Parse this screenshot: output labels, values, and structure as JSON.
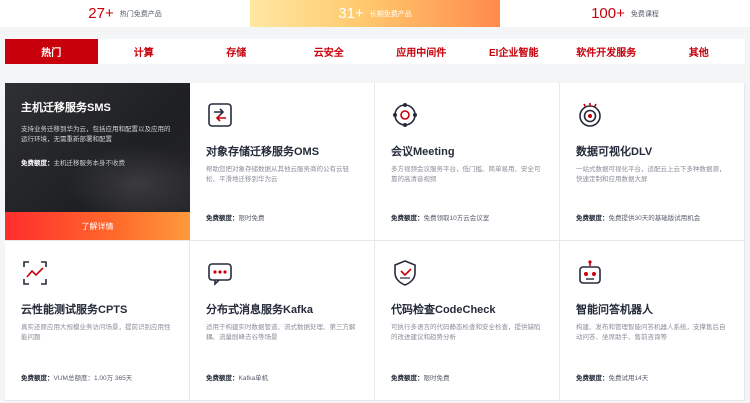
{
  "stats": [
    {
      "num": "27+",
      "label": "热门免费产品"
    },
    {
      "num": "31+",
      "label": "长期免费产品"
    },
    {
      "num": "100+",
      "label": "免费课程"
    }
  ],
  "tabs": [
    "热门",
    "计算",
    "存储",
    "云安全",
    "应用中间件",
    "EI企业智能",
    "软件开发服务",
    "其他"
  ],
  "active_tab": "热门",
  "featured": {
    "title": "主机迁移服务SMS",
    "desc": "支持业务迁移到华为云，包括应用和配置以及应用的运行环境，无需重新部署和配置",
    "free_label": "免费额度：",
    "free_value": "主机迁移服务本身不收费",
    "cta": "了解详情"
  },
  "free_label": "免费额度：",
  "cards": [
    {
      "icon": "migration-icon",
      "title": "对象存储迁移服务OMS",
      "desc": "帮助您把对象存储数据从其他云服务商的公有云轻松、平滑地迁移到华为云",
      "free": "限时免费"
    },
    {
      "icon": "meeting-icon",
      "title": "会议Meeting",
      "desc": "多方视频会议服务平台，低门槛、简单易用、安全可靠的高清音视频",
      "free": "免费领取10方云会议室"
    },
    {
      "icon": "data-visualization-icon",
      "title": "数据可视化DLV",
      "desc": "一站式数据可视化平台，适配云上云下多种数据源，快速定制和应用数据大屏",
      "free": "免费提供30天的基础版试用机会"
    },
    {
      "icon": "performance-test-icon",
      "title": "云性能测试服务CPTS",
      "desc": "真实还原应用大规模业务访问场景，提前识别应用性能问题",
      "free": "VUM总额度：1.00万 365天"
    },
    {
      "icon": "message-icon",
      "title": "分布式消息服务Kafka",
      "desc": "适用于构建实时数据管道、流式数据处理、第三方解耦、流量削峰去谷等场景",
      "free": "Kafka单机"
    },
    {
      "icon": "code-check-icon",
      "title": "代码检查CodeCheck",
      "desc": "可执行多语言的代码静态检查和安全检查，提供缺陷的改进建议和趋势分析",
      "free": "限时免费"
    },
    {
      "icon": "robot-icon",
      "title": "智能问答机器人",
      "desc": "构建、发布和管理智能问答机器人系统，支撑售后自动问答、坐席助手、售前咨询等",
      "free": "免费试用14天"
    }
  ],
  "colors": {
    "brand": "#c7000b",
    "accent_gradient_start": "#ff2d2d",
    "accent_gradient_end": "#ff9a3c"
  }
}
